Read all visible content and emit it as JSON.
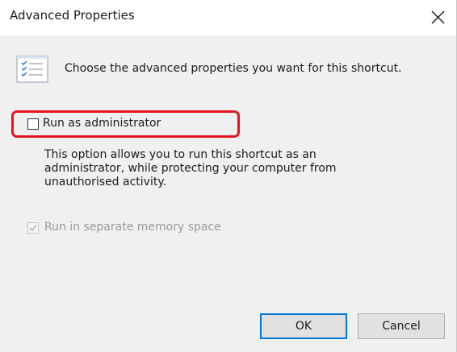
{
  "window": {
    "title": "Advanced Properties",
    "close_icon": "close-icon"
  },
  "intro": {
    "icon": "properties-list-icon",
    "text": "Choose the advanced properties you want for this shortcut."
  },
  "options": {
    "run_as_admin": {
      "label": "Run as administrator",
      "checked": false,
      "enabled": true,
      "highlight_color": "#e5131f"
    },
    "description_lines": [
      "This option allows you to run this shortcut as an",
      "administrator, while protecting your computer from",
      "unauthorised activity."
    ],
    "separate_memory": {
      "label": "Run in separate memory space",
      "checked": true,
      "enabled": false
    }
  },
  "buttons": {
    "ok_label": "OK",
    "cancel_label": "Cancel"
  },
  "colors": {
    "accent": "#0078d7",
    "dialog_bg": "#f0f0f0",
    "disabled_text": "#9a9a9a"
  }
}
